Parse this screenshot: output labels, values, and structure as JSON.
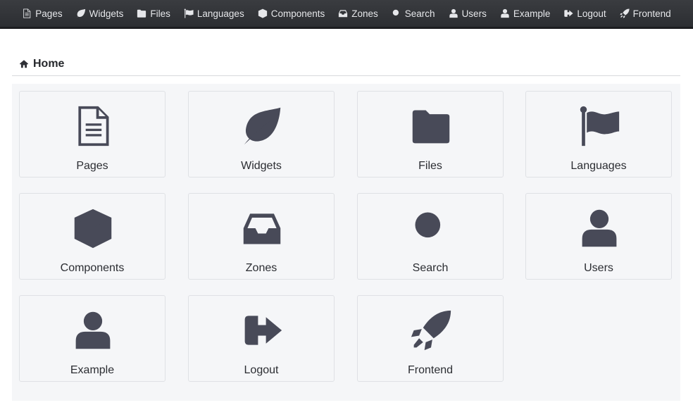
{
  "nav": {
    "items": [
      {
        "label": "Pages",
        "icon": "file-icon"
      },
      {
        "label": "Widgets",
        "icon": "leaf-icon"
      },
      {
        "label": "Files",
        "icon": "folder-icon"
      },
      {
        "label": "Languages",
        "icon": "flag-icon"
      },
      {
        "label": "Components",
        "icon": "cube-icon"
      },
      {
        "label": "Zones",
        "icon": "inbox-icon"
      },
      {
        "label": "Search",
        "icon": "search-icon"
      },
      {
        "label": "Users",
        "icon": "user-icon"
      },
      {
        "label": "Example",
        "icon": "user-icon"
      },
      {
        "label": "Logout",
        "icon": "sign-out-icon"
      },
      {
        "label": "Frontend",
        "icon": "rocket-icon"
      }
    ]
  },
  "breadcrumb": {
    "label": "Home",
    "icon": "home-icon"
  },
  "tiles": [
    {
      "label": "Pages",
      "icon": "file-icon"
    },
    {
      "label": "Widgets",
      "icon": "leaf-icon"
    },
    {
      "label": "Files",
      "icon": "folder-icon"
    },
    {
      "label": "Languages",
      "icon": "flag-icon"
    },
    {
      "label": "Components",
      "icon": "cube-icon"
    },
    {
      "label": "Zones",
      "icon": "inbox-icon"
    },
    {
      "label": "Search",
      "icon": "search-icon"
    },
    {
      "label": "Users",
      "icon": "user-icon"
    },
    {
      "label": "Example",
      "icon": "user-icon"
    },
    {
      "label": "Logout",
      "icon": "sign-out-icon"
    },
    {
      "label": "Frontend",
      "icon": "rocket-icon"
    }
  ],
  "colors": {
    "nav_bg": "#2f3135",
    "icon": "#484a58",
    "panel_bg": "#f5f6f8"
  }
}
